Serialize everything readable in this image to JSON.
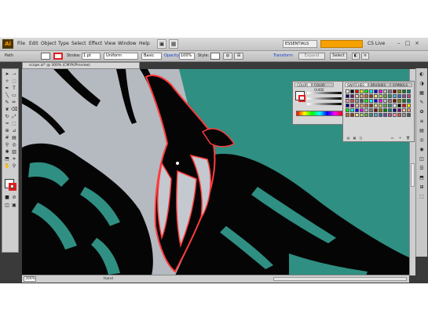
{
  "app": {
    "logo_text": "Ai",
    "menu": [
      "File",
      "Edit",
      "Object",
      "Type",
      "Select",
      "Effect",
      "View",
      "Window",
      "Help"
    ],
    "workspace": "ESSENTIALS",
    "cslive": "CS Live",
    "win_controls": [
      "–",
      "□",
      "×"
    ]
  },
  "control_bar": {
    "selection_label": "Path",
    "stroke_label": "Stroke:",
    "stroke_value": "1 pt",
    "uniform_label": "Uniform",
    "basic_label": "Basic",
    "style_label": "Style:",
    "opacity_label": "Opacity:",
    "opacity_value": "100%",
    "transform_label": "Transform",
    "image_trace_btn": "Expand",
    "expand_btn": "Select"
  },
  "document": {
    "tab_title": "scope.ai* @ 300% (CMYK/Preview)",
    "zoom_value": "300%",
    "status_text": "Hand"
  },
  "panels": {
    "color_tabs": [
      "COLOR",
      "COLOR GUIDE"
    ],
    "swatches_tabs": [
      "SWATCHES",
      "BRUSHES",
      "SYMBOLS"
    ]
  },
  "colors": {
    "teal": "#2f8f82",
    "pale": "#b5b9c0",
    "red_outline": "#ff3b3b",
    "ink": "#050505",
    "accent_orange": "#f6a100"
  },
  "tools": [
    "selection-tool",
    "direct-selection-tool",
    "magic-wand-tool",
    "lasso-tool",
    "pen-tool",
    "type-tool",
    "line-tool",
    "rectangle-tool",
    "paintbrush-tool",
    "pencil-tool",
    "blob-brush-tool",
    "eraser-tool",
    "rotate-tool",
    "scale-tool",
    "warp-tool",
    "free-transform-tool",
    "shape-builder-tool",
    "perspective-grid-tool",
    "mesh-tool",
    "gradient-tool",
    "eyedropper-tool",
    "blend-tool",
    "symbol-sprayer-tool",
    "column-graph-tool",
    "artboard-tool",
    "slice-tool",
    "hand-tool",
    "zoom-tool"
  ]
}
